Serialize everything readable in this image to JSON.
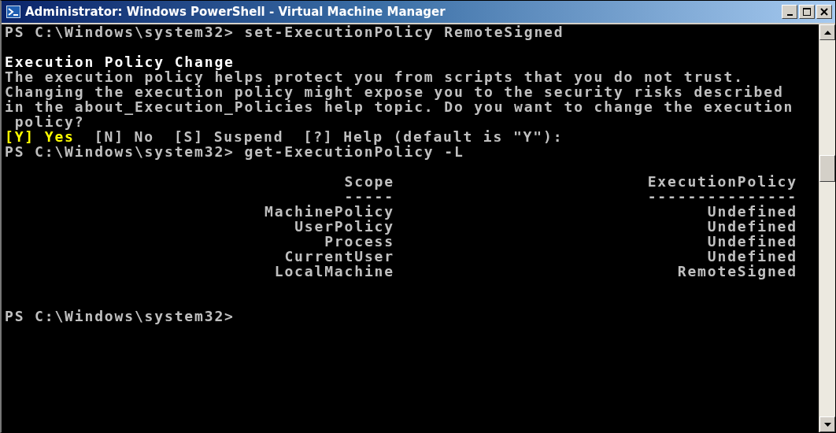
{
  "window": {
    "title": "Administrator: Windows PowerShell - Virtual Machine Manager"
  },
  "console": {
    "lines": [
      {
        "kind": "text",
        "text": "PS C:\\Windows\\system32> set-ExecutionPolicy RemoteSigned"
      },
      {
        "kind": "blank"
      },
      {
        "kind": "heading",
        "text": "Execution Policy Change"
      },
      {
        "kind": "text",
        "text": "The execution policy helps protect you from scripts that you do not trust."
      },
      {
        "kind": "text",
        "text": "Changing the execution policy might expose you to the security risks described"
      },
      {
        "kind": "text",
        "text": "in the about_Execution_Policies help topic. Do you want to change the execution"
      },
      {
        "kind": "continuation",
        "text": "policy?"
      },
      {
        "kind": "choices",
        "segments": [
          {
            "text": "[Y] Yes",
            "highlighted": true
          },
          {
            "text": "[N] No",
            "highlighted": false
          },
          {
            "text": "[S] Suspend",
            "highlighted": false
          },
          {
            "text": "[?] Help (default is \"Y\"):",
            "highlighted": false
          }
        ]
      },
      {
        "kind": "text",
        "text": "PS C:\\Windows\\system32> get-ExecutionPolicy -L"
      },
      {
        "kind": "blank"
      },
      {
        "kind": "table",
        "columns": [
          "Scope",
          "ExecutionPolicy"
        ],
        "underlines": [
          "-----",
          "---------------"
        ],
        "rows": [
          [
            "MachinePolicy",
            "Undefined"
          ],
          [
            "UserPolicy",
            "Undefined"
          ],
          [
            "Process",
            "Undefined"
          ],
          [
            "CurrentUser",
            "Undefined"
          ],
          [
            "LocalMachine",
            "RemoteSigned"
          ]
        ]
      },
      {
        "kind": "blank"
      },
      {
        "kind": "blank"
      },
      {
        "kind": "text",
        "text": "PS C:\\Windows\\system32>"
      }
    ]
  }
}
